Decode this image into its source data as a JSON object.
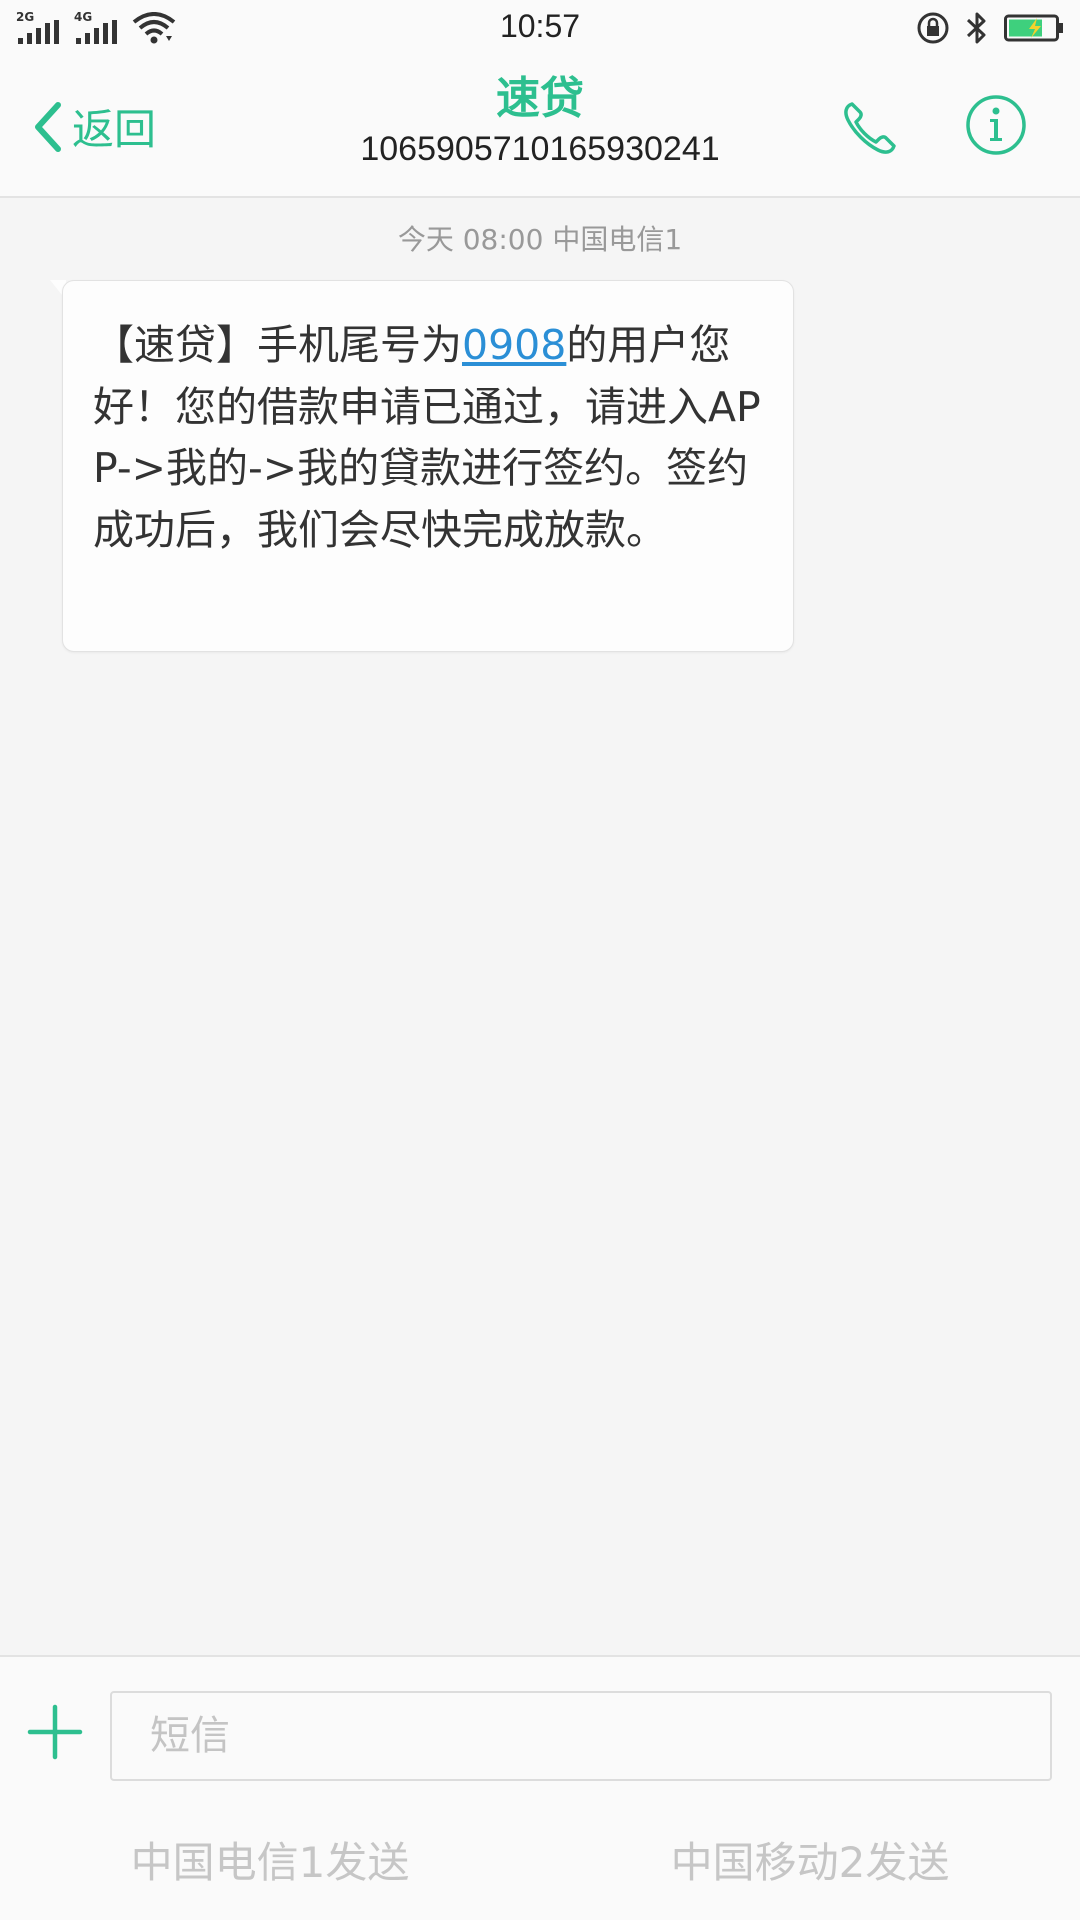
{
  "status_bar": {
    "time": "10:57",
    "sim1_network": "2G",
    "sim2_network": "4G",
    "icons": [
      "signal-icon",
      "signal-icon",
      "wifi-icon",
      "rotation-lock-icon",
      "bluetooth-icon",
      "battery-charging-icon"
    ]
  },
  "header": {
    "back_label": "返回",
    "contact_name": "速贷",
    "contact_number": "1065905710165930241"
  },
  "conversation": {
    "timestamp": "今天 08:00  中国电信1",
    "message": {
      "before_link": "【速贷】手机尾号为",
      "link_number": "0908",
      "after_link": "的用户您好！您的借款申请已通过，请进入APP->我的->我的貸款进行签约。签约成功后，我们会尽快完成放款。"
    }
  },
  "composer": {
    "input_placeholder": "短信",
    "input_value": "",
    "send_sim1_label": "中国电信1发送",
    "send_sim2_label": "中国移动2发送"
  },
  "colors": {
    "accent": "#2dbf8f",
    "link": "#2b8fd6",
    "background": "#f5f5f5",
    "disabled_text": "#c6c6c6"
  }
}
